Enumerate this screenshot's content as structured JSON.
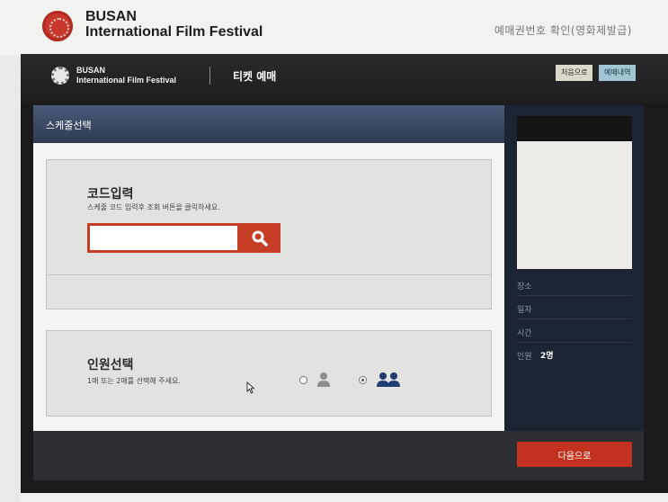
{
  "site": {
    "brand_line1": "BUSAN",
    "brand_line2": "International Film Festival",
    "ticket_confirm_link": "예매권번호 확인(영화제발급)"
  },
  "app": {
    "brand_line1": "BUSAN",
    "brand_line2": "International Film Festival",
    "section_title": "티켓 예매",
    "home_button": "처음으로",
    "history_button": "예매내역"
  },
  "panel": {
    "title": "스케줄선택"
  },
  "code_entry": {
    "title": "코드입력",
    "description": "스케줄 코드 입력후 조회 버튼을 클릭하세요.",
    "input_value": "",
    "search_icon": "search-icon"
  },
  "people_select": {
    "title": "인원선택",
    "description": "1매 또는 2매를 선택해 주세요.",
    "options": [
      {
        "icon": "single-person-icon",
        "selected": false
      },
      {
        "icon": "two-people-icon",
        "selected": true
      }
    ]
  },
  "summary": {
    "rows": [
      {
        "label": "장소",
        "value": ""
      },
      {
        "label": "일자",
        "value": ""
      },
      {
        "label": "시간",
        "value": ""
      },
      {
        "label": "인원",
        "value": "2명"
      }
    ]
  },
  "footer": {
    "next_button": "다음으로"
  },
  "colors": {
    "accent_red": "#c53d24",
    "header_navy": "#2e3a52",
    "dark_bg": "#1a1a1c"
  }
}
